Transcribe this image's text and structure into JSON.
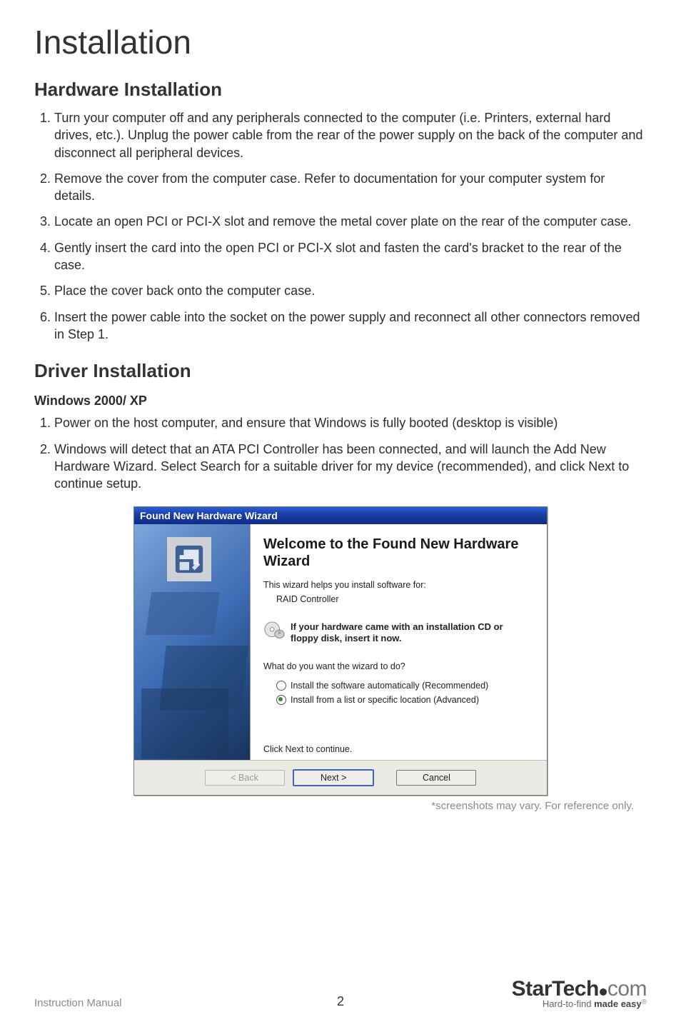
{
  "page_title": "Installation",
  "section1": {
    "title": "Hardware Installation",
    "items": [
      "Turn your computer off and any peripherals connected to the computer (i.e. Printers, external hard drives, etc.). Unplug the power cable from the rear of the power supply on the back of the computer and disconnect all peripheral devices.",
      "Remove the cover from the computer case.  Refer to documentation for your computer system for details.",
      "Locate an open PCI or PCI-X slot and remove the metal cover plate on the rear of the computer case.",
      "Gently insert the card into the open PCI or PCI-X slot and fasten the card's bracket to the rear of the case.",
      "Place the cover back onto the computer case.",
      "Insert the power cable into the socket on the power supply and reconnect all other connectors removed in Step 1."
    ]
  },
  "section2": {
    "title": "Driver Installation",
    "sub": "Windows 2000/ XP",
    "items": [
      "Power on the host computer, and ensure that Windows is fully booted (desktop is visible)",
      "Windows will detect that an ATA PCI Controller has been connected, and will launch the Add New Hardware Wizard. Select Search for a suitable driver for my device (recommended), and click Next to continue setup."
    ]
  },
  "wizard": {
    "title": "Found New Hardware Wizard",
    "heading": "Welcome to the Found New Hardware Wizard",
    "sub": "This wizard helps you install software for:",
    "device": "RAID Controller",
    "info": "If your hardware came with an installation CD or floppy disk, insert it now.",
    "question": "What do you want the wizard to do?",
    "opt1": "Install the software automatically (Recommended)",
    "opt2": "Install from a list or specific location (Advanced)",
    "click_next": "Click Next to continue.",
    "back": "< Back",
    "next": "Next >",
    "cancel": "Cancel"
  },
  "shot_note": "*screenshots may vary.  For reference only.",
  "footer": {
    "left": "Instruction Manual",
    "page": "2",
    "brand_main": "StarTech",
    "brand_suffix": "com",
    "tag_prefix": "Hard-to-find ",
    "tag_bold": "made easy",
    "reg": "®"
  }
}
